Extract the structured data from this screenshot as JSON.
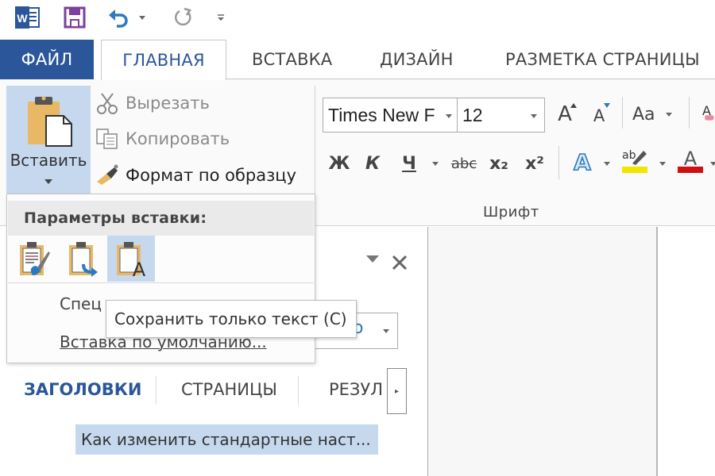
{
  "app": {
    "name": "Word",
    "accent_color": "#2b579a"
  },
  "quick_access": {
    "icons": [
      "word-logo-icon",
      "save-icon",
      "undo-icon",
      "redo-icon",
      "customize-qat-icon"
    ]
  },
  "tabs": [
    {
      "label": "ФАЙЛ",
      "active": false
    },
    {
      "label": "ГЛАВНАЯ",
      "active": true
    },
    {
      "label": "ВСТАВКА",
      "active": false
    },
    {
      "label": "ДИЗАЙН",
      "active": false
    },
    {
      "label": "РАЗМЕТКА СТРАНИЦЫ",
      "active": false
    }
  ],
  "clipboard": {
    "paste_label": "Вставить",
    "cut_label": "Вырезать",
    "copy_label": "Копировать",
    "format_painter_label": "Формат по образцу"
  },
  "font": {
    "font_name": "Times New F",
    "font_size": "12",
    "grow_label": "A",
    "shrink_label": "A",
    "case_label": "Aa",
    "bold_label": "Ж",
    "italic_label": "К",
    "underline_label": "Ч",
    "strike_label": "abc",
    "subscript_label": "x₂",
    "superscript_label": "x²",
    "group_label": "Шрифт",
    "highlight_color": "#f2e600",
    "font_color": "#d01010"
  },
  "paste_menu": {
    "header": "Параметры вставки:",
    "options": [
      {
        "name": "keep-source-formatting",
        "selected": false
      },
      {
        "name": "merge-formatting",
        "selected": false
      },
      {
        "name": "keep-text-only",
        "selected": true
      }
    ],
    "special_label": "Спец",
    "default_label": "Вставка по умолчанию..."
  },
  "tooltip": {
    "text": "Сохранить только текст (С)"
  },
  "navigation": {
    "search_partial": "о",
    "tabs": [
      {
        "label": "ЗАГОЛОВКИ",
        "active": true
      },
      {
        "label": "СТРАНИЦЫ",
        "active": false
      },
      {
        "label": "РЕЗУЛ",
        "active": false
      }
    ],
    "headings": [
      {
        "label": "Как изменить стандартные наст...",
        "selected": true
      }
    ]
  }
}
